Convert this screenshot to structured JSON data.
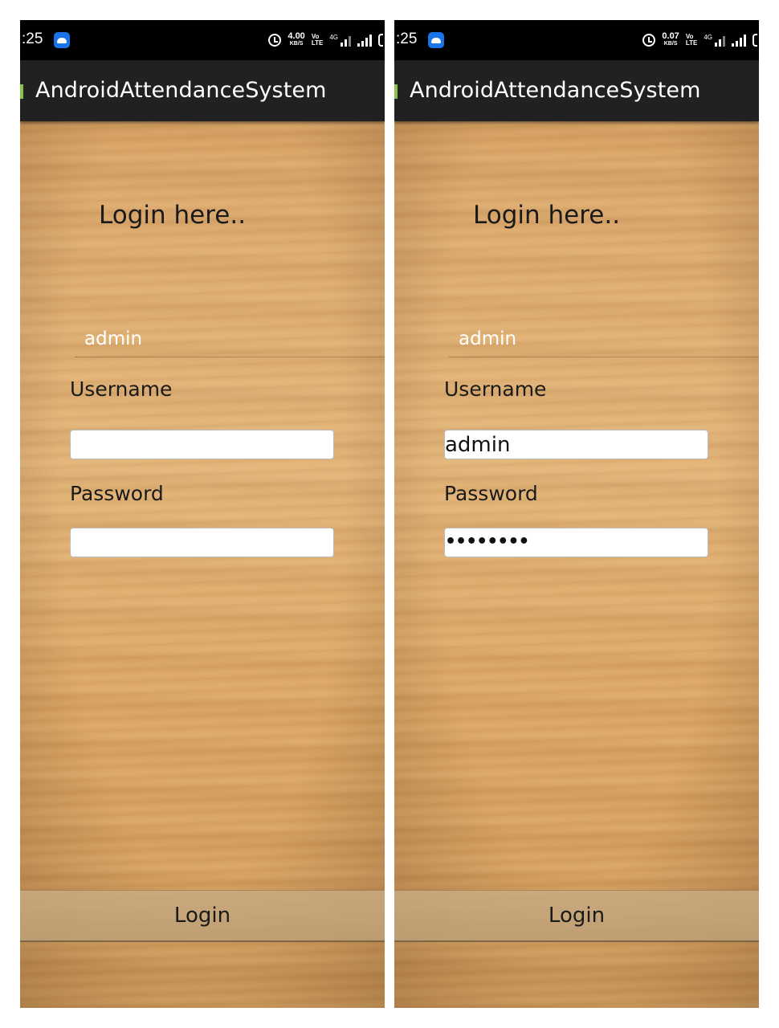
{
  "screens": [
    {
      "status": {
        "time": ":25",
        "net_speed": "4.00",
        "net_unit": "KB/S",
        "volte_top": "Vo",
        "volte_bottom": "LTE",
        "network": "4G"
      },
      "app_title": "AndroidAttendanceSystem",
      "heading": "Login here..",
      "edit_text": "admin",
      "username_label": "Username",
      "username_value": "",
      "password_label": "Password",
      "password_value": "",
      "login_button": "Login"
    },
    {
      "status": {
        "time": ":25",
        "net_speed": "0.07",
        "net_unit": "KB/S",
        "volte_top": "Vo",
        "volte_bottom": "LTE",
        "network": "4G"
      },
      "app_title": "AndroidAttendanceSystem",
      "heading": "Login here..",
      "edit_text": "admin",
      "username_label": "Username",
      "username_value": "admin",
      "password_label": "Password",
      "password_value": "••••••••",
      "login_button": "Login"
    }
  ],
  "colors": {
    "action_bar": "#212121",
    "status_bar": "#000000",
    "accent": "#8bc34a",
    "app_icon": "#1a73e8"
  }
}
